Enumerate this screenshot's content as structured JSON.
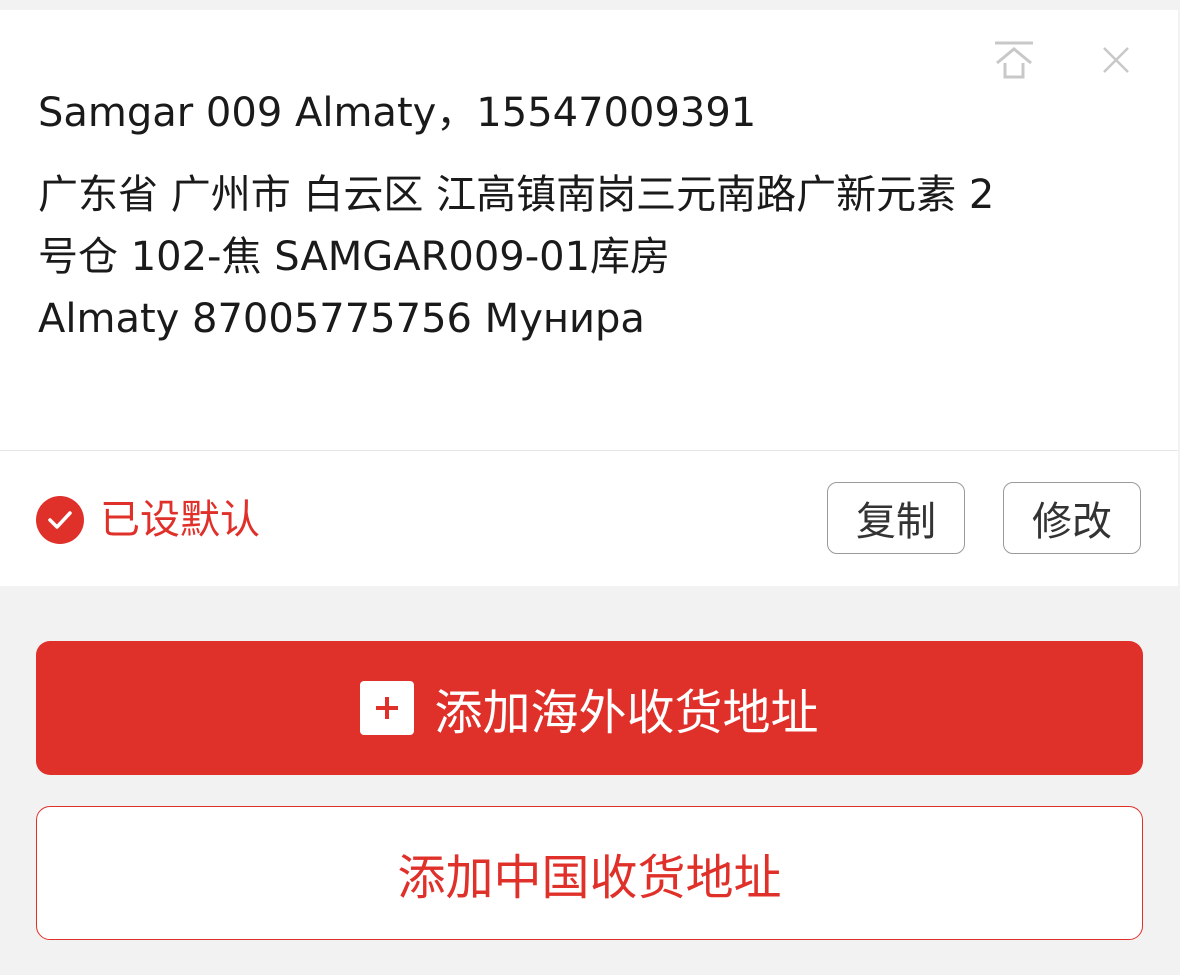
{
  "address_card": {
    "name_line": "Samgar 009 Almaty，15547009391",
    "detail_lines": [
      "广东省 广州市 白云区 江高镇南岗三元南路广新元素 2",
      "号仓 102-焦 SAMGAR009-01库房",
      "Almaty 87005775756 Мунира"
    ],
    "top_icons": [
      "pin-top-icon",
      "close-icon"
    ],
    "default_label": "已设默认",
    "copy_label": "复制",
    "edit_label": "修改"
  },
  "actions": {
    "add_overseas_label": "添加海外收货地址",
    "add_china_label": "添加中国收货地址"
  },
  "colors": {
    "accent": "#e0302a",
    "background": "#f2f2f2",
    "card": "#ffffff"
  }
}
